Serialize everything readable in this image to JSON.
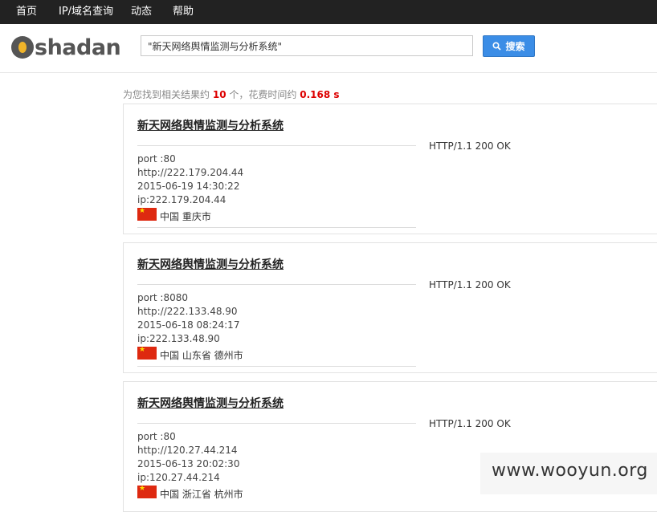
{
  "nav": [
    "首页",
    "IP/域名查询",
    "动态",
    "帮助"
  ],
  "logo": {
    "text": "shadan"
  },
  "search": {
    "value": "\"新天网络舆情监测与分析系统\"",
    "button": "搜索"
  },
  "summary": {
    "prefix": "为您找到相关结果约",
    "count": "10",
    "middle": "个，花费时间约",
    "time": "0.168 s"
  },
  "results": [
    {
      "title": "新天网络舆情监测与分析系统",
      "port": "port :80",
      "url": "http://222.179.204.44",
      "date": "2015-06-19 14:30:22",
      "ip": "ip:222.179.204.44",
      "location": "中国 重庆市",
      "status": "HTTP/1.1 200 OK"
    },
    {
      "title": "新天网络舆情监测与分析系统",
      "port": "port :8080",
      "url": "http://222.133.48.90",
      "date": "2015-06-18 08:24:17",
      "ip": "ip:222.133.48.90",
      "location": "中国 山东省 德州市",
      "status": "HTTP/1.1 200 OK"
    },
    {
      "title": "新天网络舆情监测与分析系统",
      "port": "port :80",
      "url": "http://120.27.44.214",
      "date": "2015-06-13 20:02:30",
      "ip": "ip:120.27.44.214",
      "location": "中国 浙江省 杭州市",
      "status": "HTTP/1.1 200 OK"
    }
  ],
  "watermark": "www.wooyun.org"
}
